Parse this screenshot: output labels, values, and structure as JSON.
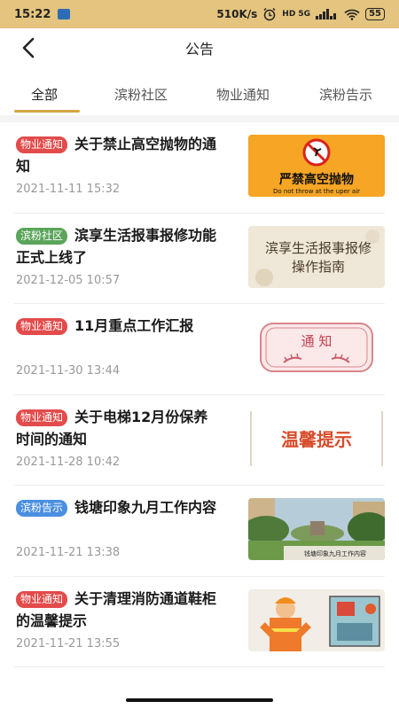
{
  "statusbar": {
    "time": "15:22",
    "network": "510K/s",
    "signal": "HD 5G",
    "battery": "55"
  },
  "header": {
    "title": "公告"
  },
  "tabs": [
    {
      "label": "全部",
      "active": true
    },
    {
      "label": "滨粉社区",
      "active": false
    },
    {
      "label": "物业通知",
      "active": false
    },
    {
      "label": "滨粉告示",
      "active": false
    }
  ],
  "items": [
    {
      "tag": "物业通知",
      "tag_color": "#e34b4b",
      "title": "关于禁止高空抛物的通知",
      "date": "2021-11-11 15:32",
      "image": {
        "line1": "严禁高空抛物",
        "line2": "Do not throw at the uper air"
      }
    },
    {
      "tag": "滨粉社区",
      "tag_color": "#5ba55b",
      "title": "滨享生活报事报修功能正式上线了",
      "date": "2021-12-05 10:57",
      "image": {
        "line1": "滨享生活报事报修",
        "line2": "操作指南"
      }
    },
    {
      "tag": "物业通知",
      "tag_color": "#e34b4b",
      "title": "11月重点工作汇报",
      "date": "2021-11-30 13:44",
      "image": {
        "line1": "通 知"
      }
    },
    {
      "tag": "物业通知",
      "tag_color": "#e34b4b",
      "title": "关于电梯12月份保养时间的通知",
      "date": "2021-11-28 10:42",
      "image": {
        "line1": "温馨提示"
      }
    },
    {
      "tag": "滨粉告示",
      "tag_color": "#4a8fe0",
      "title": "钱塘印象九月工作内容",
      "date": "2021-11-21 13:38",
      "image": {
        "line1": "钱塘印象九月工作内容"
      }
    },
    {
      "tag": "物业通知",
      "tag_color": "#e34b4b",
      "title": "关于清理消防通道鞋柜的温馨提示",
      "date": "2021-11-21 13:55",
      "image": {}
    }
  ]
}
